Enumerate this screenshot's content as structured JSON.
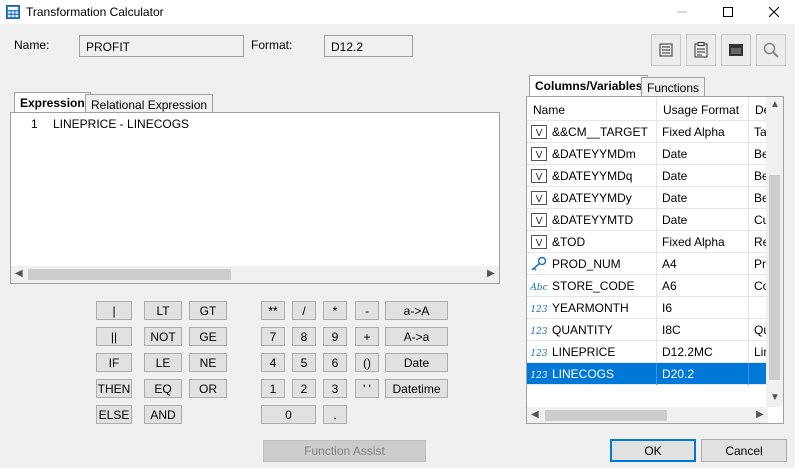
{
  "window": {
    "title": "Transformation Calculator"
  },
  "form": {
    "name_label": "Name:",
    "name_value": "PROFIT",
    "format_label": "Format:",
    "format_value": "D12.2"
  },
  "toolbar": {
    "icons": [
      "list-icon",
      "clipboard-icon",
      "window-icon",
      "search-icon"
    ]
  },
  "editor": {
    "tabs": [
      {
        "label": "Expression",
        "active": true
      },
      {
        "label": "Relational Expression",
        "active": false
      }
    ],
    "lines": [
      {
        "number": "1",
        "text": "LINEPRICE - LINECOGS"
      }
    ]
  },
  "keypad": {
    "col1": [
      "|",
      "||",
      "IF",
      "THEN",
      "ELSE"
    ],
    "col2": [
      "LT",
      "NOT",
      "LE",
      "EQ",
      "AND"
    ],
    "col3": [
      "GT",
      "GE",
      "NE",
      "OR"
    ],
    "row1": [
      "**",
      "/",
      "*",
      "-",
      "a->A"
    ],
    "row2": [
      "7",
      "8",
      "9",
      "+",
      "A->a"
    ],
    "row3": [
      "4",
      "5",
      "6",
      "()",
      "Date"
    ],
    "row4": [
      "1",
      "2",
      "3",
      "' '",
      "Datetime"
    ],
    "row5": [
      "0",
      "."
    ],
    "function_assist": "Function Assist"
  },
  "panel": {
    "tabs": [
      {
        "label": "Columns/Variables",
        "active": true
      },
      {
        "label": "Functions",
        "active": false
      }
    ],
    "columns": [
      "Name",
      "Usage Format",
      "Descr"
    ],
    "rows": [
      {
        "icon": "variable-icon",
        "name": "&&CM__TARGET",
        "format": "Fixed Alpha",
        "desc": "Ta"
      },
      {
        "icon": "variable-icon",
        "name": "&DATEYYMDm",
        "format": "Date",
        "desc": "Be"
      },
      {
        "icon": "variable-icon",
        "name": "&DATEYYMDq",
        "format": "Date",
        "desc": "Be"
      },
      {
        "icon": "variable-icon",
        "name": "&DATEYYMDy",
        "format": "Date",
        "desc": "Be"
      },
      {
        "icon": "variable-icon",
        "name": "&DATEYYMTD",
        "format": "Date",
        "desc": "Cu"
      },
      {
        "icon": "variable-icon",
        "name": "&TOD",
        "format": "Fixed Alpha",
        "desc": "Re"
      },
      {
        "icon": "key-icon",
        "name": "PROD_NUM",
        "format": "A4",
        "desc": "Pr"
      },
      {
        "icon": "alpha-icon",
        "name": "STORE_CODE",
        "format": "A6",
        "desc": "Co"
      },
      {
        "icon": "numeric-icon",
        "name": "YEARMONTH",
        "format": "I6",
        "desc": ""
      },
      {
        "icon": "numeric-icon",
        "name": "QUANTITY",
        "format": "I8C",
        "desc": "Qu"
      },
      {
        "icon": "numeric-icon",
        "name": "LINEPRICE",
        "format": "D12.2MC",
        "desc": "Lin"
      },
      {
        "icon": "numeric-icon",
        "name": "LINECOGS",
        "format": "D20.2",
        "desc": "",
        "selected": true
      }
    ]
  },
  "buttons": {
    "ok": "OK",
    "cancel": "Cancel"
  },
  "colors": {
    "selection": "#0078d7",
    "icon_blue": "#1e73be"
  }
}
